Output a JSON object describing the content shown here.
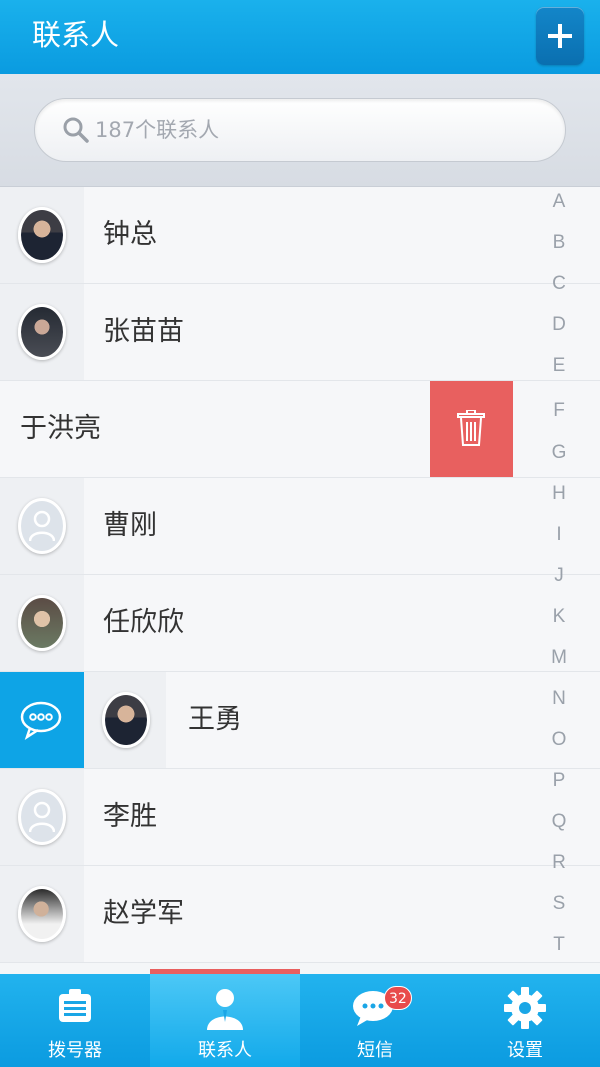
{
  "header": {
    "title": "联系人"
  },
  "search": {
    "placeholder": "187个联系人"
  },
  "contacts": [
    {
      "name": "钟总",
      "avatar": "photo"
    },
    {
      "name": "张苗苗",
      "avatar": "photo"
    },
    {
      "name": "于洪亮",
      "avatar": "none",
      "state": "swiped-delete"
    },
    {
      "name": "曹刚",
      "avatar": "default-person-icon"
    },
    {
      "name": "任欣欣",
      "avatar": "photo"
    },
    {
      "name": "王勇",
      "avatar": "photo",
      "state": "message-action-open"
    },
    {
      "name": "李胜",
      "avatar": "default-person-icon"
    },
    {
      "name": "赵学军",
      "avatar": "photo"
    }
  ],
  "alphabet": [
    "A",
    "B",
    "C",
    "D",
    "E",
    "F",
    "G",
    "H",
    "I",
    "J",
    "K",
    "M",
    "N",
    "O",
    "P",
    "Q",
    "R",
    "S",
    "T"
  ],
  "tabs": [
    {
      "label": "拨号器",
      "icon": "dialpad-icon"
    },
    {
      "label": "联系人",
      "icon": "person-icon",
      "active": true
    },
    {
      "label": "短信",
      "icon": "chat-icon",
      "badge": "32"
    },
    {
      "label": "设置",
      "icon": "gear-icon"
    }
  ],
  "colors": {
    "accent": "#0ea4e6",
    "delete": "#e8605f",
    "badge": "#e84b4b",
    "active_tab_marker": "#e85f5f"
  }
}
